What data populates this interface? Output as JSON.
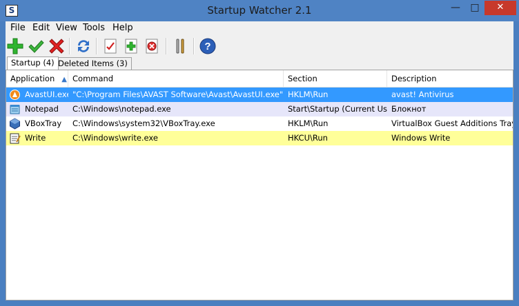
{
  "window": {
    "title": "Startup Watcher 2.1",
    "app_icon_letter": "S",
    "min_glyph": "—",
    "max_glyph": "□",
    "close_glyph": "✕"
  },
  "menu": [
    "File",
    "Edit",
    "View",
    "Tools",
    "Help"
  ],
  "toolbar": [
    {
      "name": "add-icon"
    },
    {
      "name": "enable-check-icon"
    },
    {
      "name": "remove-x-icon"
    },
    {
      "name": "refresh-icon"
    },
    {
      "name": "new-document-check-icon"
    },
    {
      "name": "new-document-add-icon"
    },
    {
      "name": "delete-document-icon"
    },
    {
      "name": "tools-settings-icon"
    },
    {
      "name": "help-icon"
    }
  ],
  "tabs": [
    {
      "label": "Startup (4)",
      "active": true
    },
    {
      "label": "Deleted Items (3)",
      "active": false
    }
  ],
  "columns": [
    "Application",
    "Command",
    "Section",
    "Description"
  ],
  "rows": [
    {
      "app": "AvastUI.exe",
      "command": "\"C:\\Program Files\\AVAST Software\\Avast\\AvastUI.exe\" /nogui",
      "section": "HKLM\\Run",
      "description": "avast! Antivirus",
      "state": "selected",
      "icon": "avast-icon"
    },
    {
      "app": "Notepad",
      "command": "C:\\Windows\\notepad.exe",
      "section": "Start\\Startup (Current User)",
      "description": "Блокнот",
      "state": "lavender",
      "icon": "notepad-icon"
    },
    {
      "app": "VBoxTray",
      "command": "C:\\Windows\\system32\\VBoxTray.exe",
      "section": "HKLM\\Run",
      "description": "VirtualBox Guest Additions Tray Application",
      "state": "normal",
      "icon": "virtualbox-icon"
    },
    {
      "app": "Write",
      "command": "C:\\Windows\\write.exe",
      "section": "HKCU\\Run",
      "description": "Windows Write",
      "state": "yellow",
      "icon": "write-icon"
    }
  ],
  "colors": {
    "titlebar": "#4f83c4",
    "selected_row": "#3399ff",
    "lavender_row": "#e6e6fa",
    "yellow_row": "#ffff99",
    "close_button": "#c7392b"
  }
}
